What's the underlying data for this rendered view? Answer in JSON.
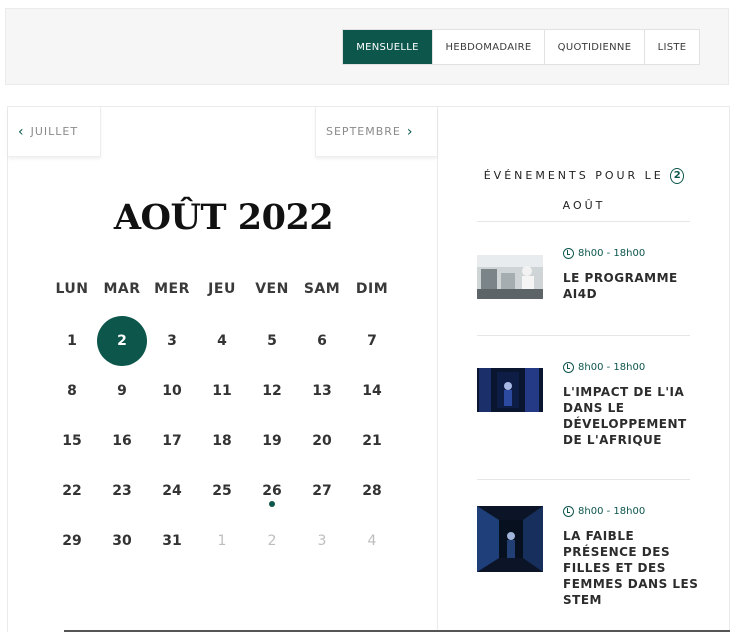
{
  "views": {
    "items": [
      "MENSUELLE",
      "HEBDOMADAIRE",
      "QUOTIDIENNE",
      "LISTE"
    ],
    "active": "MENSUELLE"
  },
  "calendar": {
    "prev_label": "JUILLET",
    "next_label": "SEPTEMBRE",
    "month_title": "AOÛT 2022",
    "weekdays": [
      "LUN",
      "MAR",
      "MER",
      "JEU",
      "VEN",
      "SAM",
      "DIM"
    ],
    "weeks": [
      [
        "1",
        "2",
        "3",
        "4",
        "5",
        "6",
        "7"
      ],
      [
        "8",
        "9",
        "10",
        "11",
        "12",
        "13",
        "14"
      ],
      [
        "15",
        "16",
        "17",
        "18",
        "19",
        "20",
        "21"
      ],
      [
        "22",
        "23",
        "24",
        "25",
        "26",
        "27",
        "28"
      ],
      [
        "29",
        "30",
        "31",
        "1",
        "2",
        "3",
        "4"
      ]
    ],
    "selected_day": "2",
    "event_day": "26",
    "accent_color": "#0c564c"
  },
  "events": {
    "header_prefix": "ÉVÉNEMENTS POUR LE",
    "header_day": "2",
    "header_month": "AOÛT",
    "items": [
      {
        "time": "8h00 - 18h00",
        "title": "LE PROGRAMME AI4D"
      },
      {
        "time": "8h00 - 18h00",
        "title": "L'IMPACT DE L'IA DANS LE DÉVELOPPEMENT DE L'AFRIQUE"
      },
      {
        "time": "8h00 - 18h00",
        "title": "LA FAIBLE PRÉSENCE DES FILLES ET DES FEMMES DANS LES STEM"
      }
    ]
  }
}
